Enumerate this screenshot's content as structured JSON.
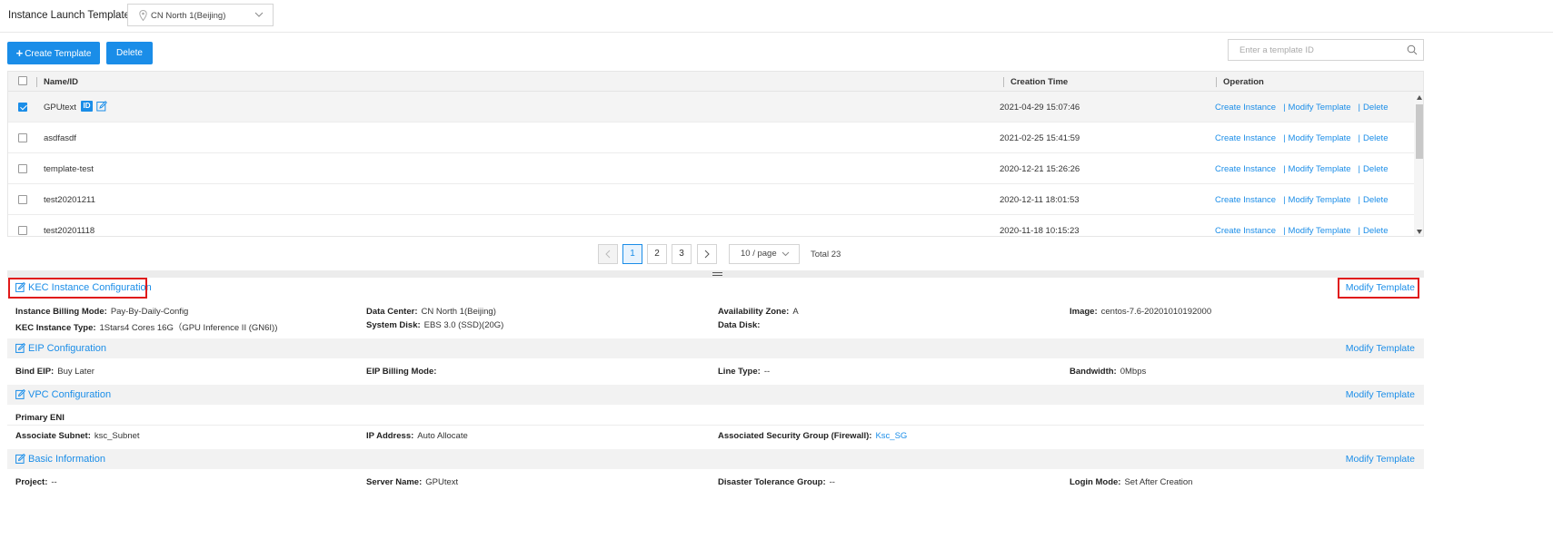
{
  "header": {
    "title": "Instance Launch Template",
    "region": "CN North 1(Beijing)"
  },
  "toolbar": {
    "create_label": "Create Template",
    "delete_label": "Delete",
    "search_placeholder": "Enter a template ID"
  },
  "table": {
    "columns": [
      "Name/ID",
      "Creation Time",
      "Operation"
    ],
    "rows": [
      {
        "name": "GPUtext",
        "time": "2021-04-29 15:07:46",
        "selected": true
      },
      {
        "name": "asdfasdf",
        "time": "2021-02-25 15:41:59",
        "selected": false
      },
      {
        "name": "template-test",
        "time": "2020-12-21 15:26:26",
        "selected": false
      },
      {
        "name": "test20201211",
        "time": "2020-12-11 18:01:53",
        "selected": false
      },
      {
        "name": "test20201118",
        "time": "2020-11-18 10:15:23",
        "selected": false
      }
    ],
    "ops": {
      "create": "Create Instance",
      "modify": "Modify Template",
      "delete": "Delete",
      "sep": "|"
    },
    "id_badge": "ID"
  },
  "pagination": {
    "pages": [
      "1",
      "2",
      "3"
    ],
    "current": "1",
    "page_size": "10 / page",
    "total": "Total 23"
  },
  "detail": {
    "modify_label": "Modify Template",
    "kec": {
      "title": "KEC Instance Configuration",
      "billing_mode_k": "Instance Billing Mode:",
      "billing_mode_v": "Pay-By-Daily-Config",
      "data_center_k": "Data Center:",
      "data_center_v": "CN North 1(Beijing)",
      "az_k": "Availability Zone:",
      "az_v": "A",
      "image_k": "Image:",
      "image_v": "centos-7.6-20201010192000",
      "type_k": "KEC Instance Type:",
      "type_v": "1Stars4 Cores 16G（GPU Inference II (GN6I))",
      "sys_disk_k": "System Disk:",
      "sys_disk_v": "EBS 3.0 (SSD)(20G)",
      "data_disk_k": "Data Disk:",
      "data_disk_v": ""
    },
    "eip": {
      "title": "EIP Configuration",
      "bind_k": "Bind EIP:",
      "bind_v": "Buy Later",
      "billing_k": "EIP Billing Mode:",
      "billing_v": "",
      "line_k": "Line Type:",
      "line_v": "--",
      "bw_k": "Bandwidth:",
      "bw_v": "0Mbps"
    },
    "vpc": {
      "title": "VPC Configuration",
      "primary_eni": "Primary ENI",
      "subnet_k": "Associate Subnet:",
      "subnet_v": "ksc_Subnet",
      "ip_k": "IP Address:",
      "ip_v": "Auto Allocate",
      "sg_k": "Associated Security Group (Firewall):",
      "sg_v": "Ksc_SG"
    },
    "basic": {
      "title": "Basic Information",
      "project_k": "Project:",
      "project_v": "--",
      "server_k": "Server Name:",
      "server_v": "GPUtext",
      "dtg_k": "Disaster Tolerance Group:",
      "dtg_v": "--",
      "login_k": "Login Mode:",
      "login_v": "Set After Creation"
    }
  },
  "colors": {
    "accent": "#1a8de8",
    "highlight_box": "#e01a1a"
  }
}
